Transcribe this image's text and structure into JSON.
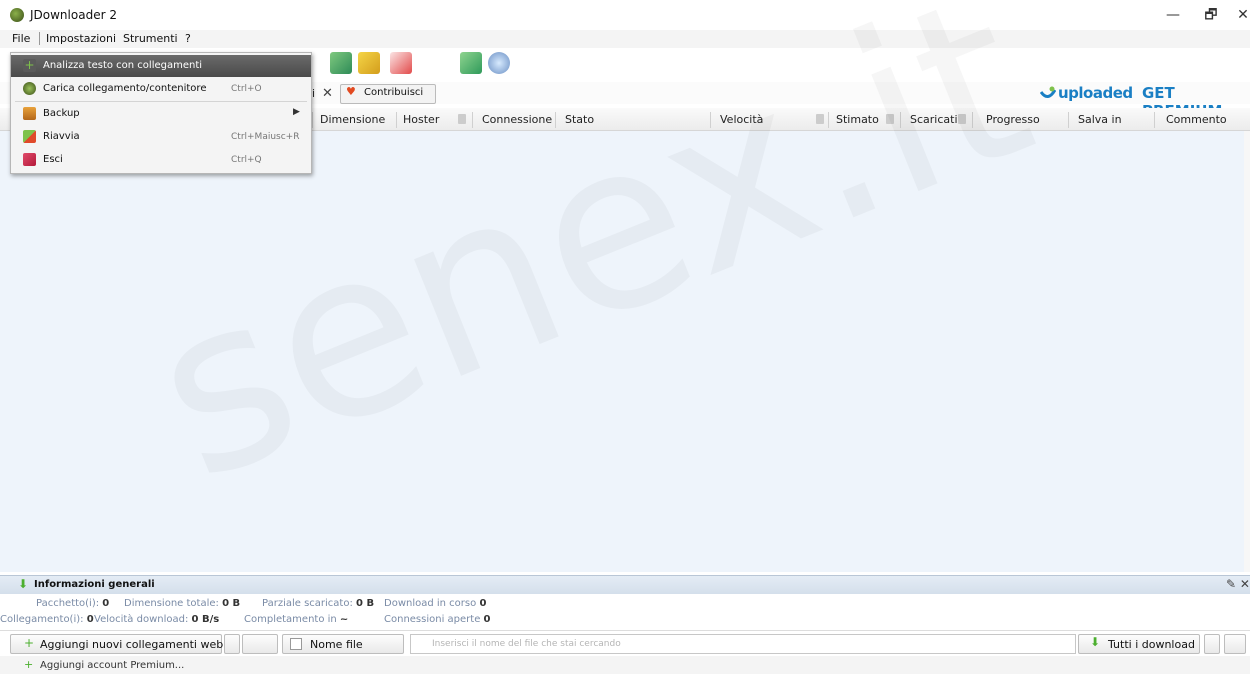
{
  "window": {
    "title": "JDownloader 2",
    "minimize": "—",
    "maximize": "🗗",
    "close": "✕"
  },
  "menubar": {
    "items": [
      "File",
      "Impostazioni",
      "Strumenti",
      "?"
    ]
  },
  "file_menu": {
    "items": [
      {
        "label": "Analizza testo con collegamenti",
        "shortcut": "",
        "icon": "add-links-icon",
        "active": true
      },
      {
        "label": "Carica collegamento/contenitore",
        "shortcut": "Ctrl+O",
        "icon": "container-icon"
      },
      {
        "label": "Backup",
        "shortcut": "",
        "icon": "backup-icon",
        "submenu": true
      },
      {
        "label": "Riavvia",
        "shortcut": "Ctrl+Maiusc+R",
        "icon": "restart-icon"
      },
      {
        "label": "Esci",
        "shortcut": "Ctrl+Q",
        "icon": "exit-icon"
      }
    ]
  },
  "tabs": {
    "partial_label": "i",
    "close": "✕",
    "contribute_label": "Contribuisci"
  },
  "brand": {
    "name": "uploaded",
    "cta": "GET PREMIUM"
  },
  "table": {
    "columns": [
      "Dimensione",
      "Hoster",
      "Connessione",
      "Stato",
      "Velocità",
      "Stimato",
      "Scaricati",
      "Progresso",
      "Salva in",
      "Commento"
    ]
  },
  "watermark": "senex.it",
  "info": {
    "title": "Informazioni generali",
    "row1": [
      {
        "label": "Pacchetto(i):",
        "value": "0"
      },
      {
        "label": "Dimensione totale:",
        "value": "0 B"
      },
      {
        "label": "Parziale scaricato:",
        "value": "0 B"
      },
      {
        "label": "Download in corso",
        "value": "0"
      }
    ],
    "row2": [
      {
        "label": "Collegamento(i):",
        "value": "0"
      },
      {
        "label": "Velocità download:",
        "value": "0 B/s"
      },
      {
        "label": "Completamento in",
        "value": "~"
      },
      {
        "label": "Connessioni aperte",
        "value": "0"
      }
    ]
  },
  "bottombar": {
    "add_links": "Aggiungi nuovi collegamenti web...",
    "filename_label": "Nome file",
    "search_placeholder": "Inserisci il nome del file che stai cercando",
    "all_downloads": "Tutti i download"
  },
  "status": {
    "add_premium": "Aggiungi account Premium..."
  },
  "colors": {
    "accent": "#1a7fc4",
    "table_bg": "#eef4fb",
    "menu_active": "#555555"
  }
}
